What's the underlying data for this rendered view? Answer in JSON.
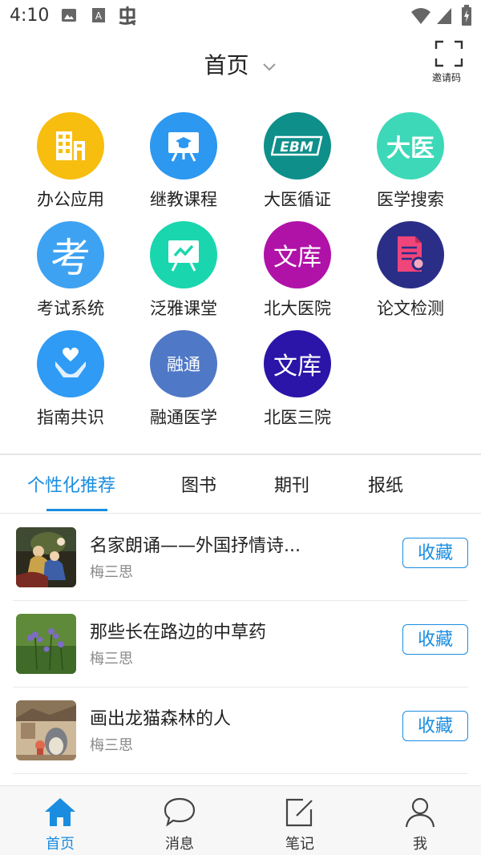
{
  "status_bar": {
    "time": "4:10"
  },
  "header": {
    "title": "首页",
    "invite_label": "邀请码"
  },
  "apps": [
    {
      "label": "办公应用",
      "icon": "office-building-icon",
      "color": "#F7BE0F"
    },
    {
      "label": "继教课程",
      "icon": "presentation-graduation-icon",
      "color": "#2C98F0"
    },
    {
      "label": "大医循证",
      "icon": "ebm-icon",
      "glyph": "EBM",
      "color": "#0E8F8A"
    },
    {
      "label": "医学搜索",
      "icon": "dayi-text-icon",
      "glyph": "大医",
      "color": "#3DD8B8"
    },
    {
      "label": "考试系统",
      "icon": "exam-character-icon",
      "glyph": "考",
      "color": "#3EA2F2"
    },
    {
      "label": "泛雅课堂",
      "icon": "classroom-board-icon",
      "color": "#19D6AE"
    },
    {
      "label": "北大医院",
      "icon": "wenku-icon",
      "glyph": "文库",
      "color": "#B012A8"
    },
    {
      "label": "论文检测",
      "icon": "document-search-icon",
      "color": "#2A2E86"
    },
    {
      "label": "指南共识",
      "icon": "hands-heart-icon",
      "color": "#2F9BF5"
    },
    {
      "label": "融通医学",
      "icon": "rongtong-icon",
      "glyph": "融通",
      "color": "#4F78C6"
    },
    {
      "label": "北医三院",
      "icon": "wenku-icon",
      "glyph": "文库",
      "color": "#2A15A8"
    }
  ],
  "tabs": [
    {
      "label": "个性化推荐",
      "active": true
    },
    {
      "label": "图书",
      "active": false
    },
    {
      "label": "期刊",
      "active": false
    },
    {
      "label": "报纸",
      "active": false
    }
  ],
  "recommendations": [
    {
      "title": "名家朗诵——外国抒情诗...",
      "author": "梅三思",
      "action": "收藏",
      "thumb": "painting"
    },
    {
      "title": "那些长在路边的中草药",
      "author": "梅三思",
      "action": "收藏",
      "thumb": "flowers"
    },
    {
      "title": "画出龙猫森林的人",
      "author": "梅三思",
      "action": "收藏",
      "thumb": "totoro"
    }
  ],
  "bottom_nav": [
    {
      "label": "首页",
      "icon": "home-icon",
      "active": true
    },
    {
      "label": "消息",
      "icon": "chat-bubble-icon",
      "active": false
    },
    {
      "label": "笔记",
      "icon": "edit-note-icon",
      "active": false
    },
    {
      "label": "我",
      "icon": "user-icon",
      "active": false
    }
  ],
  "colors": {
    "accent": "#1A8DE0"
  }
}
